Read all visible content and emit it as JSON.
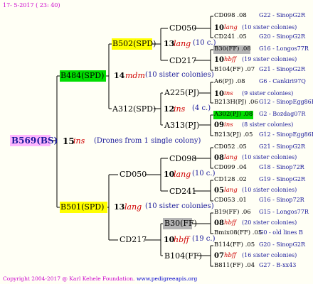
{
  "header": {
    "date": "17- 5-2017 ( 23: 40)"
  },
  "footer": {
    "copyright": "Copyright 2004-2017 @ Karl Kehele Foundation.",
    "website": "www.pedigreeapis.org"
  },
  "colors": {
    "root_box": "#ffb6ff",
    "spd_green": "#00dd00",
    "spd_yellow": "#ffff00",
    "ff_gray": "#b4b4b4",
    "line": "#000000"
  },
  "root": {
    "label": "B569(BS)",
    "count": "15",
    "keyword": "ins",
    "note": "(Drones from 1 single colony)"
  },
  "g1": {
    "upper": {
      "label": "B484(SPD)",
      "count": "14",
      "keyword": "mdm",
      "note": "(10 sister colonies)"
    },
    "lower": {
      "label": "B501(SPD)",
      "count": "13",
      "keyword": "lang",
      "note": "(10 sister colonies)"
    }
  },
  "g2": {
    "b502": {
      "label": "B502(SPD)",
      "count": "13",
      "keyword": "lang",
      "note": "(10 c.)"
    },
    "a312": {
      "label": "A312(SPD)",
      "count": "12",
      "keyword": "ins",
      "note": "(4 c.)"
    },
    "cd050": {
      "label": "CD050",
      "count": "10",
      "keyword": "lang",
      "note": "(10 c.)"
    },
    "cd217": {
      "label": "CD217",
      "count": "10",
      "keyword": "hbff",
      "note": "(19 c.)"
    }
  },
  "g3": {
    "cd050a": "CD050",
    "cd217a": "CD217",
    "a225": "A225(PJ)",
    "a313": "A313(PJ)",
    "cd098": "CD098",
    "cd241": "CD241",
    "b30": "B30(FF)",
    "b104": "B104(FF)"
  },
  "g4": [
    {
      "label": "CD098 .08",
      "ref": "G22 - SinopG2R"
    },
    {
      "count": "10",
      "keyword": "lang",
      "note": "(10 sister colonies)"
    },
    {
      "label": "CD241 .05",
      "ref": "G20 - SinopG2R"
    },
    {
      "label": "B30(FF) .08",
      "ref": "G16 - Longos77R"
    },
    {
      "count": "10",
      "keyword": "hbff",
      "note": "(19 sister colonies)"
    },
    {
      "label": "B104(FF) .07",
      "ref": "G21 - SinopG2R"
    },
    {
      "label": "A6(PJ) .08",
      "ref": "G6 - Cankiri97Q"
    },
    {
      "count": "10",
      "keyword": "ins",
      "note": "(9 sister colonies)"
    },
    {
      "label": "B213H(PJ) .06",
      "ref": "G12 - SinopEgg86R"
    },
    {
      "label": "A302(PJ) .08",
      "ref": "G2 - Bozdag07R"
    },
    {
      "count": "09",
      "keyword": "ins",
      "note": "(8 sister colonies)"
    },
    {
      "label": "B213(PJ) .05",
      "ref": "G12 - SinopEgg86R"
    },
    {
      "label": "CD052 .05",
      "ref": "G21 - SinopG2R"
    },
    {
      "count": "08",
      "keyword": "lang",
      "note": "(10 sister colonies)"
    },
    {
      "label": "CD099 .04",
      "ref": "G18 - Sinop72R"
    },
    {
      "label": "CD128 .02",
      "ref": "G19 - SinopG2R"
    },
    {
      "count": "05",
      "keyword": "lang",
      "note": "(10 sister colonies)"
    },
    {
      "label": "CD053 .01",
      "ref": "G16 - Sinop72R"
    },
    {
      "label": "B19(FF) .06",
      "ref": "G15 - Longos77R"
    },
    {
      "count": "08",
      "keyword": "hbff",
      "note": "(20 sister colonies)"
    },
    {
      "label": "Bmix08(FF) .05",
      "ref": "G0 - old lines B"
    },
    {
      "label": "B114(FF) .05",
      "ref": "G20 - SinopG2R"
    },
    {
      "count": "07",
      "keyword": "hbff",
      "note": "(16 sister colonies)"
    },
    {
      "label": "B811(FF) .04",
      "ref": "G27 - B-xx43"
    }
  ]
}
